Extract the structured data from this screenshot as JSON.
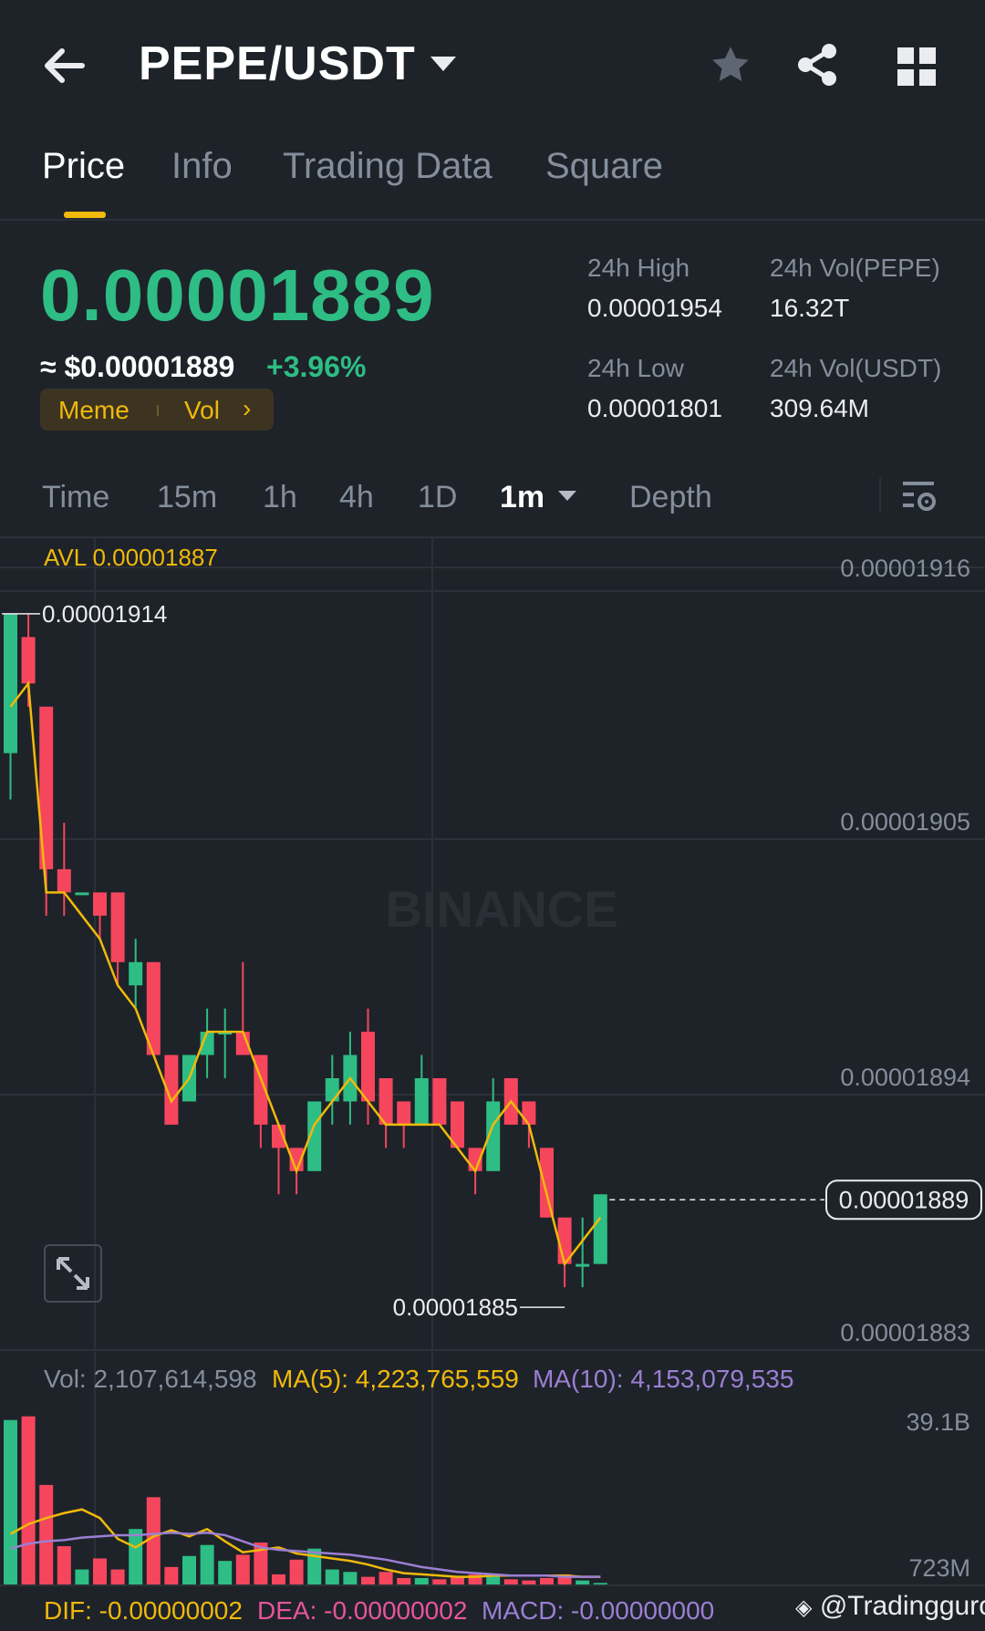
{
  "header": {
    "back_icon": "arrow-left-icon",
    "pair": "PEPE/USDT",
    "favorite_icon": "star-icon",
    "share_icon": "share-icon",
    "grid_icon": "grid-icon"
  },
  "tabs": [
    {
      "label": "Price",
      "active": true
    },
    {
      "label": "Info"
    },
    {
      "label": "Trading Data"
    },
    {
      "label": "Square"
    }
  ],
  "ticker": {
    "last_price": "0.00001889",
    "usd_price": "≈ $0.00001889",
    "change": "+3.96%",
    "tags": [
      "Meme",
      "Vol"
    ],
    "stats": [
      {
        "label": "24h High",
        "value": "0.00001954"
      },
      {
        "label": "24h Vol(PEPE)",
        "value": "16.32T"
      },
      {
        "label": "24h Low",
        "value": "0.00001801"
      },
      {
        "label": "24h Vol(USDT)",
        "value": "309.64M"
      }
    ]
  },
  "intervals": {
    "items": [
      "Time",
      "15m",
      "1h",
      "4h",
      "1D",
      "1m",
      "Depth"
    ],
    "active": "1m",
    "settings_icon": "chart-settings-icon"
  },
  "colors": {
    "up": "#2ebd85",
    "down": "#f6465d",
    "accent": "#f0b90b",
    "ma10": "#9b7fd4",
    "background": "#1e2329"
  },
  "chart_data": {
    "type": "candlestick",
    "interval": "1m",
    "avl_label": "AVL 0.00001887",
    "watermark": "BINANCE",
    "y_ticks": [
      "0.00001916",
      "0.00001905",
      "0.00001894",
      "0.00001883"
    ],
    "y_tick_values": [
      1.916e-05,
      1.905e-05,
      1.894e-05,
      1.883e-05
    ],
    "high_marker": "0.00001914",
    "low_marker": "0.00001885",
    "last_price_label": "0.00001889",
    "candles": [
      {
        "o": 1.908e-05,
        "h": 1.914e-05,
        "l": 1.906e-05,
        "c": 1.914e-05
      },
      {
        "o": 1.913e-05,
        "h": 1.914e-05,
        "l": 1.91e-05,
        "c": 1.911e-05
      },
      {
        "o": 1.91e-05,
        "h": 1.91e-05,
        "l": 1.901e-05,
        "c": 1.903e-05
      },
      {
        "o": 1.903e-05,
        "h": 1.905e-05,
        "l": 1.901e-05,
        "c": 1.902e-05
      },
      {
        "o": 1.902e-05,
        "h": 1.902e-05,
        "l": 1.902e-05,
        "c": 1.902e-05
      },
      {
        "o": 1.902e-05,
        "h": 1.902e-05,
        "l": 1.9e-05,
        "c": 1.901e-05
      },
      {
        "o": 1.902e-05,
        "h": 1.902e-05,
        "l": 1.898e-05,
        "c": 1.899e-05
      },
      {
        "o": 1.898e-05,
        "h": 1.9e-05,
        "l": 1.897e-05,
        "c": 1.899e-05
      },
      {
        "o": 1.899e-05,
        "h": 1.899e-05,
        "l": 1.895e-05,
        "c": 1.895e-05
      },
      {
        "o": 1.895e-05,
        "h": 1.895e-05,
        "l": 1.892e-05,
        "c": 1.892e-05
      },
      {
        "o": 1.893e-05,
        "h": 1.895e-05,
        "l": 1.893e-05,
        "c": 1.895e-05
      },
      {
        "o": 1.895e-05,
        "h": 1.897e-05,
        "l": 1.894e-05,
        "c": 1.896e-05
      },
      {
        "o": 1.896e-05,
        "h": 1.897e-05,
        "l": 1.894e-05,
        "c": 1.896e-05
      },
      {
        "o": 1.896e-05,
        "h": 1.899e-05,
        "l": 1.895e-05,
        "c": 1.895e-05
      },
      {
        "o": 1.895e-05,
        "h": 1.895e-05,
        "l": 1.891e-05,
        "c": 1.892e-05
      },
      {
        "o": 1.892e-05,
        "h": 1.892e-05,
        "l": 1.889e-05,
        "c": 1.891e-05
      },
      {
        "o": 1.891e-05,
        "h": 1.891e-05,
        "l": 1.889e-05,
        "c": 1.89e-05
      },
      {
        "o": 1.89e-05,
        "h": 1.893e-05,
        "l": 1.89e-05,
        "c": 1.893e-05
      },
      {
        "o": 1.893e-05,
        "h": 1.895e-05,
        "l": 1.892e-05,
        "c": 1.894e-05
      },
      {
        "o": 1.893e-05,
        "h": 1.896e-05,
        "l": 1.892e-05,
        "c": 1.895e-05
      },
      {
        "o": 1.896e-05,
        "h": 1.897e-05,
        "l": 1.892e-05,
        "c": 1.893e-05
      },
      {
        "o": 1.894e-05,
        "h": 1.894e-05,
        "l": 1.891e-05,
        "c": 1.892e-05
      },
      {
        "o": 1.893e-05,
        "h": 1.893e-05,
        "l": 1.891e-05,
        "c": 1.892e-05
      },
      {
        "o": 1.892e-05,
        "h": 1.895e-05,
        "l": 1.892e-05,
        "c": 1.894e-05
      },
      {
        "o": 1.894e-05,
        "h": 1.894e-05,
        "l": 1.892e-05,
        "c": 1.892e-05
      },
      {
        "o": 1.893e-05,
        "h": 1.893e-05,
        "l": 1.891e-05,
        "c": 1.891e-05
      },
      {
        "o": 1.891e-05,
        "h": 1.891e-05,
        "l": 1.889e-05,
        "c": 1.89e-05
      },
      {
        "o": 1.89e-05,
        "h": 1.894e-05,
        "l": 1.89e-05,
        "c": 1.893e-05
      },
      {
        "o": 1.894e-05,
        "h": 1.894e-05,
        "l": 1.892e-05,
        "c": 1.892e-05
      },
      {
        "o": 1.893e-05,
        "h": 1.893e-05,
        "l": 1.891e-05,
        "c": 1.892e-05
      },
      {
        "o": 1.891e-05,
        "h": 1.891e-05,
        "l": 1.888e-05,
        "c": 1.888e-05
      },
      {
        "o": 1.888e-05,
        "h": 1.888e-05,
        "l": 1.885e-05,
        "c": 1.886e-05
      },
      {
        "o": 1.886e-05,
        "h": 1.888e-05,
        "l": 1.885e-05,
        "c": 1.886e-05
      },
      {
        "o": 1.886e-05,
        "h": 1.889e-05,
        "l": 1.886e-05,
        "c": 1.889e-05
      }
    ],
    "ma_line": [
      1.91e-05,
      1.911e-05,
      1.902e-05,
      1.902e-05,
      1.901e-05,
      1.9e-05,
      1.898e-05,
      1.897e-05,
      1.895e-05,
      1.893e-05,
      1.894e-05,
      1.896e-05,
      1.896e-05,
      1.896e-05,
      1.894e-05,
      1.892e-05,
      1.89e-05,
      1.892e-05,
      1.893e-05,
      1.894e-05,
      1.893e-05,
      1.892e-05,
      1.892e-05,
      1.892e-05,
      1.892e-05,
      1.891e-05,
      1.89e-05,
      1.892e-05,
      1.893e-05,
      1.892e-05,
      1.889e-05,
      1.886e-05,
      1.887e-05,
      1.888e-05
    ],
    "volume": {
      "label": "Vol: 2,107,614,598",
      "ma5_label": "MA(5): 4,223,765,559",
      "ma10_label": "MA(10): 4,153,079,535",
      "y_ticks": [
        "39.1B",
        "723M"
      ],
      "values": [
        13.5,
        13.8,
        8.2,
        3.2,
        1.3,
        2.2,
        1.3,
        4.6,
        7.2,
        1.5,
        2.4,
        3.3,
        2.0,
        2.5,
        3.5,
        0.9,
        2.1,
        3.0,
        1.3,
        1.1,
        0.7,
        1.1,
        0.6,
        0.6,
        0.5,
        0.7,
        0.9,
        0.9,
        0.5,
        0.4,
        0.6,
        0.9,
        0.4,
        0.2
      ],
      "ma5": [
        4.2,
        5.0,
        5.5,
        5.9,
        6.2,
        5.5,
        3.8,
        3.1,
        4.0,
        4.5,
        4.0,
        4.6,
        3.6,
        2.7,
        2.9,
        3.1,
        2.6,
        2.4,
        2.2,
        2.0,
        1.7,
        1.3,
        1.0,
        0.9,
        0.8,
        0.7,
        0.7,
        0.8,
        0.8,
        0.8,
        0.8,
        0.8,
        0.7,
        0.7
      ],
      "ma10": [
        3.0,
        3.4,
        3.6,
        3.7,
        3.9,
        4.0,
        4.1,
        4.1,
        4.2,
        4.3,
        4.2,
        4.3,
        4.1,
        3.6,
        3.1,
        2.9,
        2.8,
        2.7,
        2.6,
        2.5,
        2.3,
        2.1,
        1.8,
        1.5,
        1.3,
        1.1,
        1.0,
        0.9,
        0.8,
        0.8,
        0.8,
        0.7,
        0.7,
        0.7
      ]
    },
    "macd": {
      "dif_label": "DIF: -0.00000002",
      "dea_label": "DEA: -0.00000002",
      "macd_label": "MACD: -0.00000000"
    }
  },
  "footer": {
    "watermark": "@Tradingguro"
  }
}
